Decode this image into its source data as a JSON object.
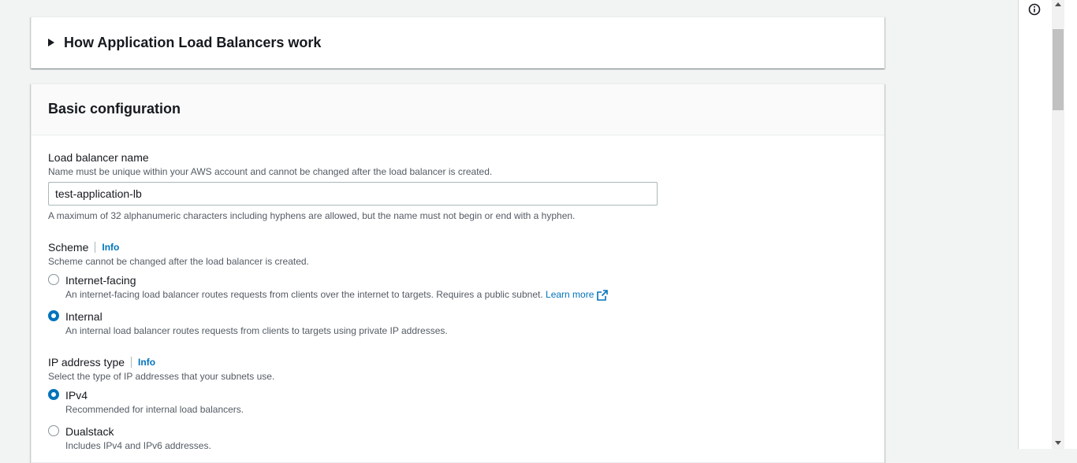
{
  "expander": {
    "title": "How Application Load Balancers work"
  },
  "basic_config": {
    "title": "Basic configuration",
    "lb_name": {
      "label": "Load balancer name",
      "description": "Name must be unique within your AWS account and cannot be changed after the load balancer is created.",
      "value": "test-application-lb",
      "constraint": "A maximum of 32 alphanumeric characters including hyphens are allowed, but the name must not begin or end with a hyphen."
    },
    "scheme": {
      "label": "Scheme",
      "info": "Info",
      "description": "Scheme cannot be changed after the load balancer is created.",
      "options": [
        {
          "label": "Internet-facing",
          "description": "An internet-facing load balancer routes requests from clients over the internet to targets. Requires a public subnet.",
          "link": "Learn more",
          "selected": false
        },
        {
          "label": "Internal",
          "description": "An internal load balancer routes requests from clients to targets using private IP addresses.",
          "selected": true
        }
      ]
    },
    "ip_type": {
      "label": "IP address type",
      "info": "Info",
      "description": "Select the type of IP addresses that your subnets use.",
      "options": [
        {
          "label": "IPv4",
          "description": "Recommended for internal load balancers.",
          "selected": true
        },
        {
          "label": "Dualstack",
          "description": "Includes IPv4 and IPv6 addresses.",
          "selected": false
        }
      ]
    }
  },
  "icons": {
    "caret": "caret-right-icon",
    "external": "external-link-icon",
    "info": "info-circle-icon"
  },
  "colors": {
    "accent": "#0073bb",
    "text": "#16191f",
    "muted": "#545b64",
    "background": "#f2f3f3"
  }
}
